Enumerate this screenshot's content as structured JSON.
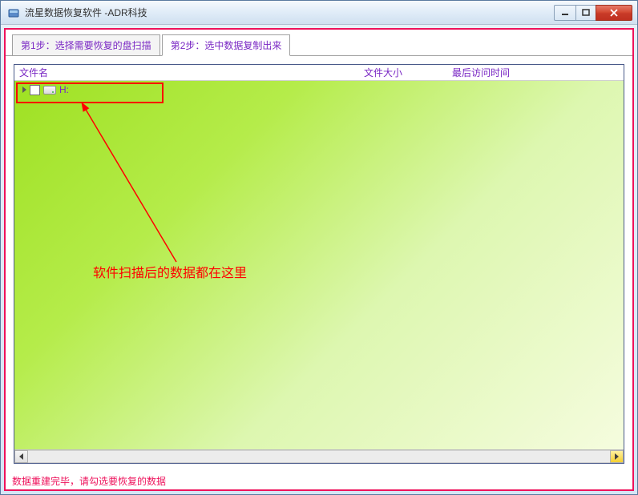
{
  "window": {
    "title": "流星数据恢复软件  -ADR科技"
  },
  "tabs": {
    "step1": "第1步：选择需要恢复的盘扫描",
    "step2": "第2步：选中数据复制出来"
  },
  "columns": {
    "filename": "文件名",
    "filesize": "文件大小",
    "lastaccess": "最后访问时间"
  },
  "tree": {
    "drive_label": "H:"
  },
  "annotation": {
    "text": "软件扫描后的数据都在这里"
  },
  "status": {
    "text": "数据重建完毕，请勾选要恢复的数据"
  }
}
